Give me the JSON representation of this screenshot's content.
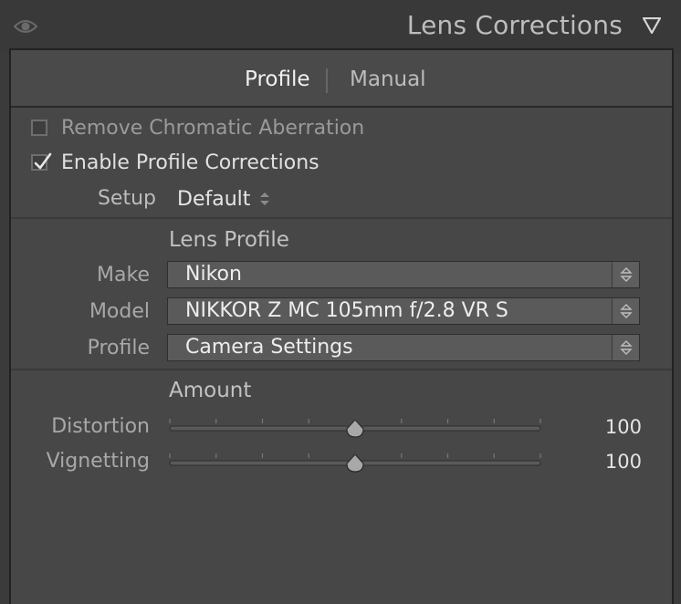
{
  "header": {
    "title": "Lens Corrections",
    "eye_icon": "eye-icon",
    "collapse_icon": "triangle-down-icon"
  },
  "tabs": [
    {
      "label": "Profile",
      "active": true
    },
    {
      "label": "Manual",
      "active": false
    }
  ],
  "options": {
    "remove_ca": {
      "label": "Remove Chromatic Aberration",
      "checked": false
    },
    "enable_profile": {
      "label": "Enable Profile Corrections",
      "checked": true
    }
  },
  "setup": {
    "label": "Setup",
    "value": "Default"
  },
  "lens_profile": {
    "heading": "Lens Profile",
    "make": {
      "label": "Make",
      "value": "Nikon"
    },
    "model": {
      "label": "Model",
      "value": "NIKKOR Z MC 105mm f/2.8 VR S"
    },
    "profile": {
      "label": "Profile",
      "value": "Camera Settings"
    }
  },
  "amount": {
    "heading": "Amount",
    "distortion": {
      "label": "Distortion",
      "value": "100",
      "position": 0.5
    },
    "vignetting": {
      "label": "Vignetting",
      "value": "100",
      "position": 0.5
    }
  },
  "colors": {
    "panel_bg": "#474747",
    "header_bg": "#393939",
    "dropdown_bg": "#5a5a5a",
    "text_active": "#f0f0f0"
  }
}
